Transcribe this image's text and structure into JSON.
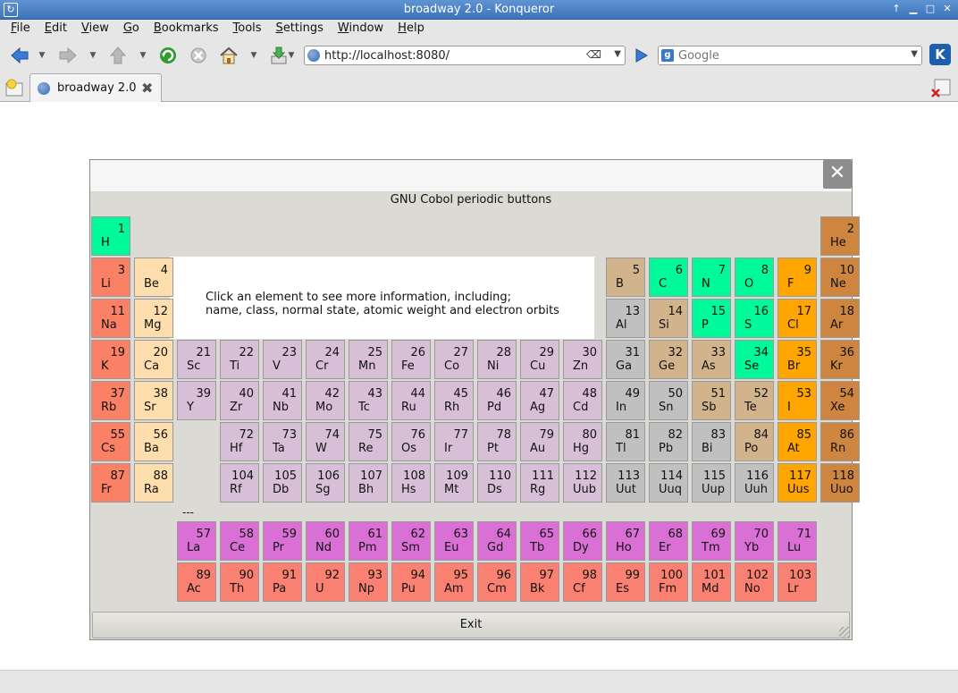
{
  "window": {
    "title": "broadway 2.0 - Konqueror"
  },
  "menu": [
    {
      "label": "File",
      "u": "F",
      "rest": "ile"
    },
    {
      "label": "Edit",
      "u": "E",
      "rest": "dit"
    },
    {
      "label": "View",
      "u": "V",
      "rest": "iew"
    },
    {
      "label": "Go",
      "u": "G",
      "rest": "o"
    },
    {
      "label": "Bookmarks",
      "u": "B",
      "rest": "ookmarks"
    },
    {
      "label": "Tools",
      "u": "T",
      "rest": "ools"
    },
    {
      "label": "Settings",
      "u": "S",
      "rest": "ettings"
    },
    {
      "label": "Window",
      "u": "W",
      "rest": "indow"
    },
    {
      "label": "Help",
      "u": "H",
      "rest": "elp"
    }
  ],
  "toolbar": {
    "url": "http://localhost:8080/",
    "search_placeholder": "Google"
  },
  "tabs": [
    {
      "label": "broadway 2.0"
    }
  ],
  "dialog": {
    "title": "GNU Cobol periodic buttons",
    "info_line1": "Click an element to see more information, including;",
    "info_line2": "name, class, normal state, atomic weight and electron orbits",
    "separator": "---",
    "exit_label": "Exit",
    "close_glyph": "✕"
  },
  "colors": {
    "alkali": "#fa8066",
    "alkaline": "#ffdead",
    "transition": "#d8bfd8",
    "poor": "#c0c0c0",
    "metalloid": "#d2b48c",
    "nonmetal": "#00fa9a",
    "halogen": "#ffa500",
    "noble": "#cd853f",
    "lanthanide": "#da70d6",
    "actinide": "#fa8072"
  },
  "elements": [
    {
      "n": "1",
      "s": "H",
      "c": "nonmetal",
      "r": 1,
      "col": 1
    },
    {
      "n": "2",
      "s": "He",
      "c": "noble",
      "r": 1,
      "col": 18
    },
    {
      "n": "3",
      "s": "Li",
      "c": "alkali",
      "r": 2,
      "col": 1
    },
    {
      "n": "4",
      "s": "Be",
      "c": "alkaline",
      "r": 2,
      "col": 2
    },
    {
      "n": "5",
      "s": "B",
      "c": "metalloid",
      "r": 2,
      "col": 13
    },
    {
      "n": "6",
      "s": "C",
      "c": "nonmetal",
      "r": 2,
      "col": 14
    },
    {
      "n": "7",
      "s": "N",
      "c": "nonmetal",
      "r": 2,
      "col": 15
    },
    {
      "n": "8",
      "s": "O",
      "c": "nonmetal",
      "r": 2,
      "col": 16
    },
    {
      "n": "9",
      "s": "F",
      "c": "halogen",
      "r": 2,
      "col": 17
    },
    {
      "n": "10",
      "s": "Ne",
      "c": "noble",
      "r": 2,
      "col": 18
    },
    {
      "n": "11",
      "s": "Na",
      "c": "alkali",
      "r": 3,
      "col": 1
    },
    {
      "n": "12",
      "s": "Mg",
      "c": "alkaline",
      "r": 3,
      "col": 2
    },
    {
      "n": "13",
      "s": "Al",
      "c": "poor",
      "r": 3,
      "col": 13
    },
    {
      "n": "14",
      "s": "Si",
      "c": "metalloid",
      "r": 3,
      "col": 14
    },
    {
      "n": "15",
      "s": "P",
      "c": "nonmetal",
      "r": 3,
      "col": 15
    },
    {
      "n": "16",
      "s": "S",
      "c": "nonmetal",
      "r": 3,
      "col": 16
    },
    {
      "n": "17",
      "s": "Cl",
      "c": "halogen",
      "r": 3,
      "col": 17
    },
    {
      "n": "18",
      "s": "Ar",
      "c": "noble",
      "r": 3,
      "col": 18
    },
    {
      "n": "19",
      "s": "K",
      "c": "alkali",
      "r": 4,
      "col": 1
    },
    {
      "n": "20",
      "s": "Ca",
      "c": "alkaline",
      "r": 4,
      "col": 2
    },
    {
      "n": "21",
      "s": "Sc",
      "c": "transition",
      "r": 4,
      "col": 3
    },
    {
      "n": "22",
      "s": "Ti",
      "c": "transition",
      "r": 4,
      "col": 4
    },
    {
      "n": "23",
      "s": "V",
      "c": "transition",
      "r": 4,
      "col": 5
    },
    {
      "n": "24",
      "s": "Cr",
      "c": "transition",
      "r": 4,
      "col": 6
    },
    {
      "n": "25",
      "s": "Mn",
      "c": "transition",
      "r": 4,
      "col": 7
    },
    {
      "n": "26",
      "s": "Fe",
      "c": "transition",
      "r": 4,
      "col": 8
    },
    {
      "n": "27",
      "s": "Co",
      "c": "transition",
      "r": 4,
      "col": 9
    },
    {
      "n": "28",
      "s": "Ni",
      "c": "transition",
      "r": 4,
      "col": 10
    },
    {
      "n": "29",
      "s": "Cu",
      "c": "transition",
      "r": 4,
      "col": 11
    },
    {
      "n": "30",
      "s": "Zn",
      "c": "transition",
      "r": 4,
      "col": 12
    },
    {
      "n": "31",
      "s": "Ga",
      "c": "poor",
      "r": 4,
      "col": 13
    },
    {
      "n": "32",
      "s": "Ge",
      "c": "metalloid",
      "r": 4,
      "col": 14
    },
    {
      "n": "33",
      "s": "As",
      "c": "metalloid",
      "r": 4,
      "col": 15
    },
    {
      "n": "34",
      "s": "Se",
      "c": "nonmetal",
      "r": 4,
      "col": 16
    },
    {
      "n": "35",
      "s": "Br",
      "c": "halogen",
      "r": 4,
      "col": 17
    },
    {
      "n": "36",
      "s": "Kr",
      "c": "noble",
      "r": 4,
      "col": 18
    },
    {
      "n": "37",
      "s": "Rb",
      "c": "alkali",
      "r": 5,
      "col": 1
    },
    {
      "n": "38",
      "s": "Sr",
      "c": "alkaline",
      "r": 5,
      "col": 2
    },
    {
      "n": "39",
      "s": "Y",
      "c": "transition",
      "r": 5,
      "col": 3
    },
    {
      "n": "40",
      "s": "Zr",
      "c": "transition",
      "r": 5,
      "col": 4
    },
    {
      "n": "41",
      "s": "Nb",
      "c": "transition",
      "r": 5,
      "col": 5
    },
    {
      "n": "42",
      "s": "Mo",
      "c": "transition",
      "r": 5,
      "col": 6
    },
    {
      "n": "43",
      "s": "Tc",
      "c": "transition",
      "r": 5,
      "col": 7
    },
    {
      "n": "44",
      "s": "Ru",
      "c": "transition",
      "r": 5,
      "col": 8
    },
    {
      "n": "45",
      "s": "Rh",
      "c": "transition",
      "r": 5,
      "col": 9
    },
    {
      "n": "46",
      "s": "Pd",
      "c": "transition",
      "r": 5,
      "col": 10
    },
    {
      "n": "47",
      "s": "Ag",
      "c": "transition",
      "r": 5,
      "col": 11
    },
    {
      "n": "48",
      "s": "Cd",
      "c": "transition",
      "r": 5,
      "col": 12
    },
    {
      "n": "49",
      "s": "In",
      "c": "poor",
      "r": 5,
      "col": 13
    },
    {
      "n": "50",
      "s": "Sn",
      "c": "poor",
      "r": 5,
      "col": 14
    },
    {
      "n": "51",
      "s": "Sb",
      "c": "metalloid",
      "r": 5,
      "col": 15
    },
    {
      "n": "52",
      "s": "Te",
      "c": "metalloid",
      "r": 5,
      "col": 16
    },
    {
      "n": "53",
      "s": "I",
      "c": "halogen",
      "r": 5,
      "col": 17
    },
    {
      "n": "54",
      "s": "Xe",
      "c": "noble",
      "r": 5,
      "col": 18
    },
    {
      "n": "55",
      "s": "Cs",
      "c": "alkali",
      "r": 6,
      "col": 1
    },
    {
      "n": "56",
      "s": "Ba",
      "c": "alkaline",
      "r": 6,
      "col": 2
    },
    {
      "n": "72",
      "s": "Hf",
      "c": "transition",
      "r": 6,
      "col": 4
    },
    {
      "n": "73",
      "s": "Ta",
      "c": "transition",
      "r": 6,
      "col": 5
    },
    {
      "n": "74",
      "s": "W",
      "c": "transition",
      "r": 6,
      "col": 6
    },
    {
      "n": "75",
      "s": "Re",
      "c": "transition",
      "r": 6,
      "col": 7
    },
    {
      "n": "76",
      "s": "Os",
      "c": "transition",
      "r": 6,
      "col": 8
    },
    {
      "n": "77",
      "s": "Ir",
      "c": "transition",
      "r": 6,
      "col": 9
    },
    {
      "n": "78",
      "s": "Pt",
      "c": "transition",
      "r": 6,
      "col": 10
    },
    {
      "n": "79",
      "s": "Au",
      "c": "transition",
      "r": 6,
      "col": 11
    },
    {
      "n": "80",
      "s": "Hg",
      "c": "transition",
      "r": 6,
      "col": 12
    },
    {
      "n": "81",
      "s": "Tl",
      "c": "poor",
      "r": 6,
      "col": 13
    },
    {
      "n": "82",
      "s": "Pb",
      "c": "poor",
      "r": 6,
      "col": 14
    },
    {
      "n": "83",
      "s": "Bi",
      "c": "poor",
      "r": 6,
      "col": 15
    },
    {
      "n": "84",
      "s": "Po",
      "c": "metalloid",
      "r": 6,
      "col": 16
    },
    {
      "n": "85",
      "s": "At",
      "c": "halogen",
      "r": 6,
      "col": 17
    },
    {
      "n": "86",
      "s": "Rn",
      "c": "noble",
      "r": 6,
      "col": 18
    },
    {
      "n": "87",
      "s": "Fr",
      "c": "alkali",
      "r": 7,
      "col": 1
    },
    {
      "n": "88",
      "s": "Ra",
      "c": "alkaline",
      "r": 7,
      "col": 2
    },
    {
      "n": "104",
      "s": "Rf",
      "c": "transition",
      "r": 7,
      "col": 4
    },
    {
      "n": "105",
      "s": "Db",
      "c": "transition",
      "r": 7,
      "col": 5
    },
    {
      "n": "106",
      "s": "Sg",
      "c": "transition",
      "r": 7,
      "col": 6
    },
    {
      "n": "107",
      "s": "Bh",
      "c": "transition",
      "r": 7,
      "col": 7
    },
    {
      "n": "108",
      "s": "Hs",
      "c": "transition",
      "r": 7,
      "col": 8
    },
    {
      "n": "109",
      "s": "Mt",
      "c": "transition",
      "r": 7,
      "col": 9
    },
    {
      "n": "110",
      "s": "Ds",
      "c": "transition",
      "r": 7,
      "col": 10
    },
    {
      "n": "111",
      "s": "Rg",
      "c": "transition",
      "r": 7,
      "col": 11
    },
    {
      "n": "112",
      "s": "Uub",
      "c": "transition",
      "r": 7,
      "col": 12
    },
    {
      "n": "113",
      "s": "Uut",
      "c": "poor",
      "r": 7,
      "col": 13
    },
    {
      "n": "114",
      "s": "Uuq",
      "c": "poor",
      "r": 7,
      "col": 14
    },
    {
      "n": "115",
      "s": "Uup",
      "c": "poor",
      "r": 7,
      "col": 15
    },
    {
      "n": "116",
      "s": "Uuh",
      "c": "poor",
      "r": 7,
      "col": 16
    },
    {
      "n": "117",
      "s": "Uus",
      "c": "halogen",
      "r": 7,
      "col": 17
    },
    {
      "n": "118",
      "s": "Uuo",
      "c": "noble",
      "r": 7,
      "col": 18
    },
    {
      "n": "57",
      "s": "La",
      "c": "lanthanide",
      "r": 8,
      "col": 3
    },
    {
      "n": "58",
      "s": "Ce",
      "c": "lanthanide",
      "r": 8,
      "col": 4
    },
    {
      "n": "59",
      "s": "Pr",
      "c": "lanthanide",
      "r": 8,
      "col": 5
    },
    {
      "n": "60",
      "s": "Nd",
      "c": "lanthanide",
      "r": 8,
      "col": 6
    },
    {
      "n": "61",
      "s": "Pm",
      "c": "lanthanide",
      "r": 8,
      "col": 7
    },
    {
      "n": "62",
      "s": "Sm",
      "c": "lanthanide",
      "r": 8,
      "col": 8
    },
    {
      "n": "63",
      "s": "Eu",
      "c": "lanthanide",
      "r": 8,
      "col": 9
    },
    {
      "n": "64",
      "s": "Gd",
      "c": "lanthanide",
      "r": 8,
      "col": 10
    },
    {
      "n": "65",
      "s": "Tb",
      "c": "lanthanide",
      "r": 8,
      "col": 11
    },
    {
      "n": "66",
      "s": "Dy",
      "c": "lanthanide",
      "r": 8,
      "col": 12
    },
    {
      "n": "67",
      "s": "Ho",
      "c": "lanthanide",
      "r": 8,
      "col": 13
    },
    {
      "n": "68",
      "s": "Er",
      "c": "lanthanide",
      "r": 8,
      "col": 14
    },
    {
      "n": "69",
      "s": "Tm",
      "c": "lanthanide",
      "r": 8,
      "col": 15
    },
    {
      "n": "70",
      "s": "Yb",
      "c": "lanthanide",
      "r": 8,
      "col": 16
    },
    {
      "n": "71",
      "s": "Lu",
      "c": "lanthanide",
      "r": 8,
      "col": 17
    },
    {
      "n": "89",
      "s": "Ac",
      "c": "actinide",
      "r": 9,
      "col": 3
    },
    {
      "n": "90",
      "s": "Th",
      "c": "actinide",
      "r": 9,
      "col": 4
    },
    {
      "n": "91",
      "s": "Pa",
      "c": "actinide",
      "r": 9,
      "col": 5
    },
    {
      "n": "92",
      "s": "U",
      "c": "actinide",
      "r": 9,
      "col": 6
    },
    {
      "n": "93",
      "s": "Np",
      "c": "actinide",
      "r": 9,
      "col": 7
    },
    {
      "n": "94",
      "s": "Pu",
      "c": "actinide",
      "r": 9,
      "col": 8
    },
    {
      "n": "95",
      "s": "Am",
      "c": "actinide",
      "r": 9,
      "col": 9
    },
    {
      "n": "96",
      "s": "Cm",
      "c": "actinide",
      "r": 9,
      "col": 10
    },
    {
      "n": "97",
      "s": "Bk",
      "c": "actinide",
      "r": 9,
      "col": 11
    },
    {
      "n": "98",
      "s": "Cf",
      "c": "actinide",
      "r": 9,
      "col": 12
    },
    {
      "n": "99",
      "s": "Es",
      "c": "actinide",
      "r": 9,
      "col": 13
    },
    {
      "n": "100",
      "s": "Fm",
      "c": "actinide",
      "r": 9,
      "col": 14
    },
    {
      "n": "101",
      "s": "Md",
      "c": "actinide",
      "r": 9,
      "col": 15
    },
    {
      "n": "102",
      "s": "No",
      "c": "actinide",
      "r": 9,
      "col": 16
    },
    {
      "n": "103",
      "s": "Lr",
      "c": "actinide",
      "r": 9,
      "col": 17
    }
  ]
}
